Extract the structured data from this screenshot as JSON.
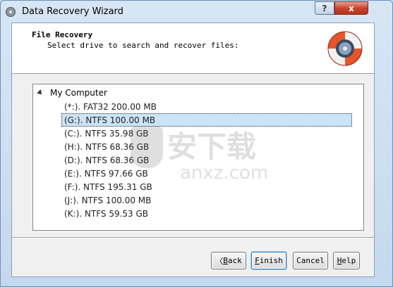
{
  "window": {
    "title": "Data Recovery Wizard",
    "help_btn": "?",
    "close_btn": "x"
  },
  "header": {
    "title": "File Recovery",
    "subtitle": "Select drive to search and recover files:",
    "icon": "lifebuoy-drive-icon"
  },
  "tree": {
    "root_label": "My Computer",
    "drives": [
      {
        "label": "(*:). FAT32 200.00 MB",
        "selected": false
      },
      {
        "label": "(G:). NTFS 100.00 MB",
        "selected": true
      },
      {
        "label": "(C:). NTFS 35.98 GB",
        "selected": false
      },
      {
        "label": "(H:). NTFS 68.36 GB",
        "selected": false
      },
      {
        "label": "(D:). NTFS 68.36 GB",
        "selected": false
      },
      {
        "label": "(E:). NTFS 97.66 GB",
        "selected": false
      },
      {
        "label": "(F:). NTFS 195.31 GB",
        "selected": false
      },
      {
        "label": "(J:). NTFS 100.00 MB",
        "selected": false
      },
      {
        "label": "(K:). NTFS 59.53 GB",
        "selected": false
      }
    ]
  },
  "buttons": {
    "back_prefix": "〈 ",
    "back_ul": "B",
    "back_rest": "ack",
    "finish_ul": "F",
    "finish_rest": "inish",
    "cancel": "Cancel",
    "help_ul": "H",
    "help_rest": "elp"
  },
  "watermark": {
    "cn": "安下载",
    "en": "anxz.com"
  },
  "colors": {
    "selection": "#cce4f7",
    "close_red": "#c8452b",
    "frame": "#c9dcef"
  }
}
